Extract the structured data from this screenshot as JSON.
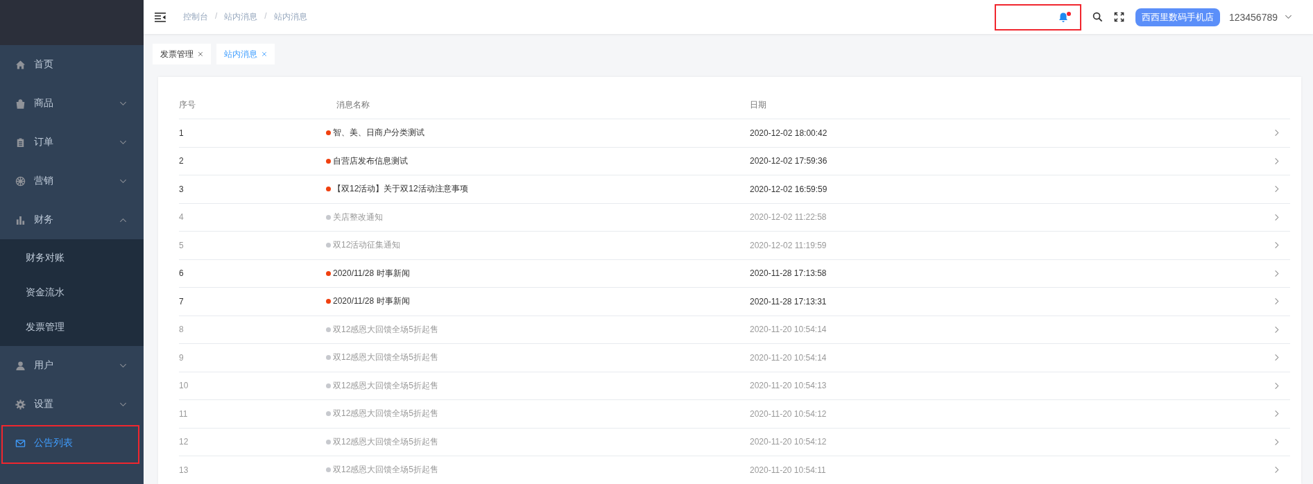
{
  "sidebar": {
    "items": [
      {
        "label": "首页",
        "selected": false,
        "highlighted": false
      },
      {
        "label": "商品",
        "selected": false,
        "highlighted": false,
        "expanded": false
      },
      {
        "label": "订单",
        "selected": false,
        "highlighted": false,
        "expanded": false
      },
      {
        "label": "营销",
        "selected": false,
        "highlighted": false,
        "expanded": false
      },
      {
        "label": "财务",
        "selected": false,
        "highlighted": false,
        "expanded": true,
        "children": [
          {
            "label": "财务对账",
            "selected": false
          },
          {
            "label": "资金流水",
            "selected": false
          },
          {
            "label": "发票管理",
            "selected": false
          }
        ]
      },
      {
        "label": "用户",
        "selected": false,
        "highlighted": false,
        "expanded": false
      },
      {
        "label": "设置",
        "selected": false,
        "highlighted": false,
        "expanded": false
      },
      {
        "label": "公告列表",
        "selected": true,
        "highlighted": true
      }
    ]
  },
  "breadcrumb": [
    {
      "label": "控制台"
    },
    {
      "separator": "/",
      "label": "站内消息"
    },
    {
      "separator": "/",
      "label": "站内消息"
    }
  ],
  "notifications": {
    "unread": true,
    "highlighted": true
  },
  "shop_badge": "西西里数码手机店",
  "username": "123456789",
  "tabs": [
    {
      "label": "发票管理",
      "selected": false
    },
    {
      "label": "站内消息",
      "selected": true
    }
  ],
  "table": {
    "columns": [
      "序号",
      "消息名称",
      "日期"
    ],
    "rows": [
      {
        "index": "1",
        "title": "智、美、日商户分类测试",
        "date": "2020-12-02 18:00:42",
        "unread": true
      },
      {
        "index": "2",
        "title": "自营店发布信息测试",
        "date": "2020-12-02 17:59:36",
        "unread": true
      },
      {
        "index": "3",
        "title": "【双12活动】关于双12活动注意事项",
        "date": "2020-12-02 16:59:59",
        "unread": true
      },
      {
        "index": "4",
        "title": "关店整改通知",
        "date": "2020-12-02 11:22:58",
        "unread": false
      },
      {
        "index": "5",
        "title": "双12活动征集通知",
        "date": "2020-12-02 11:19:59",
        "unread": false
      },
      {
        "index": "6",
        "title": "2020/11/28 时事新闻",
        "date": "2020-11-28 17:13:58",
        "unread": true
      },
      {
        "index": "7",
        "title": "2020/11/28 时事新闻",
        "date": "2020-11-28 17:13:31",
        "unread": true
      },
      {
        "index": "8",
        "title": "双12感恩大回馈全场5折起售",
        "date": "2020-11-20 10:54:14",
        "unread": false
      },
      {
        "index": "9",
        "title": "双12感恩大回馈全场5折起售",
        "date": "2020-11-20 10:54:14",
        "unread": false
      },
      {
        "index": "10",
        "title": "双12感恩大回馈全场5折起售",
        "date": "2020-11-20 10:54:13",
        "unread": false
      },
      {
        "index": "11",
        "title": "双12感恩大回馈全场5折起售",
        "date": "2020-11-20 10:54:12",
        "unread": false
      },
      {
        "index": "12",
        "title": "双12感恩大回馈全场5折起售",
        "date": "2020-11-20 10:54:12",
        "unread": false
      },
      {
        "index": "13",
        "title": "双12感恩大回馈全场5折起售",
        "date": "2020-11-20 10:54:11",
        "unread": false
      }
    ]
  }
}
